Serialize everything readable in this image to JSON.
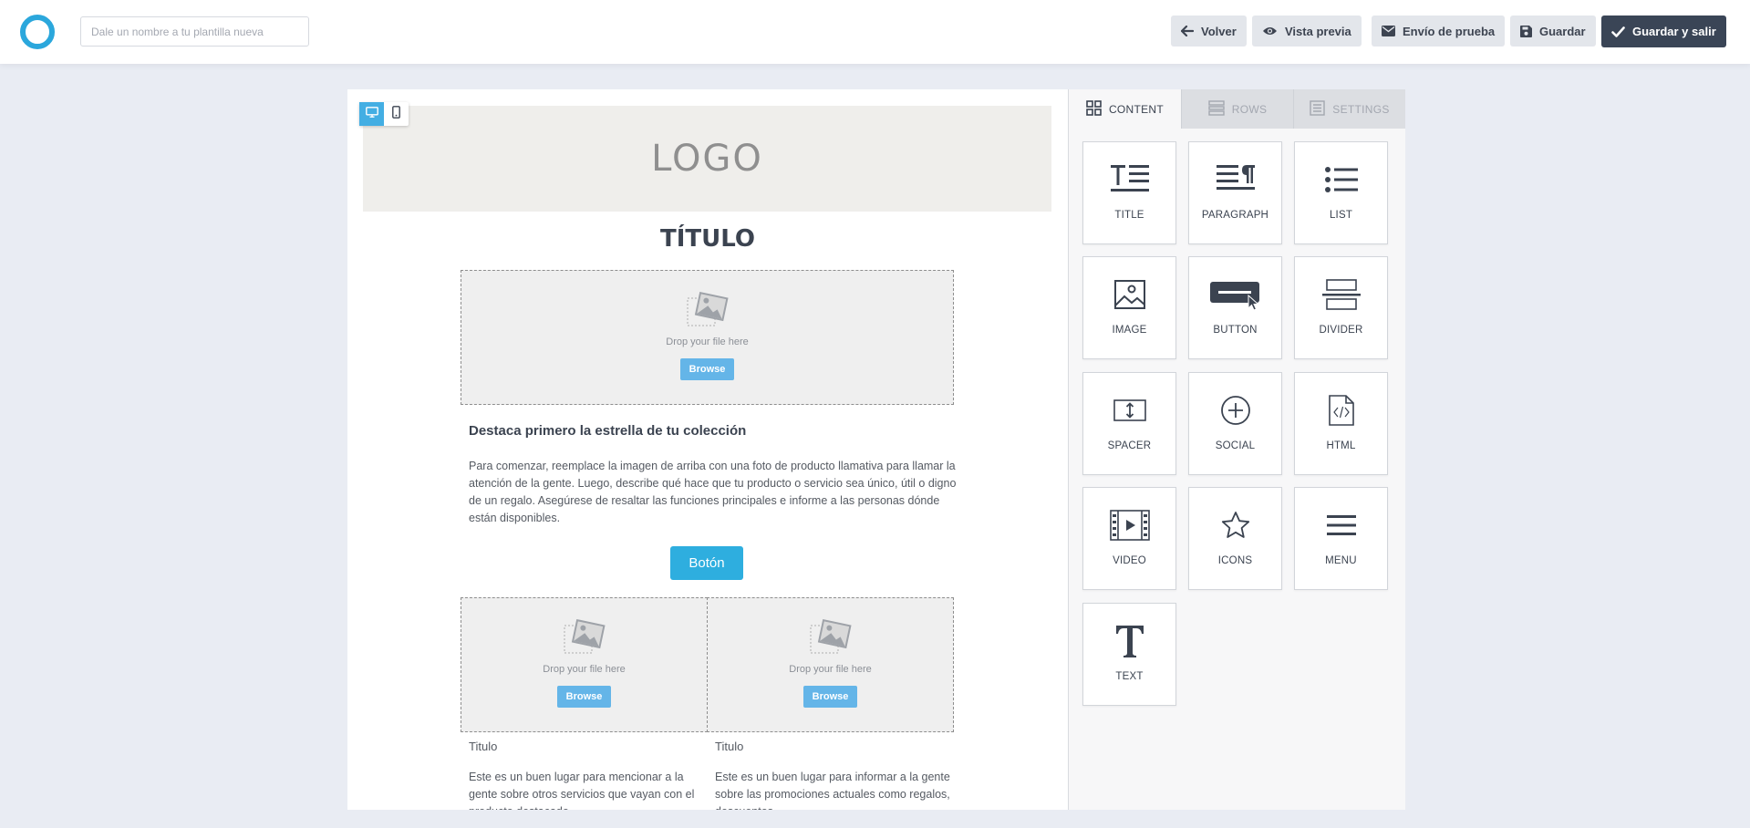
{
  "header": {
    "name_placeholder": "Dale un nombre a tu plantilla nueva",
    "buttons": {
      "back": "Volver",
      "preview": "Vista previa",
      "test_send": "Envío de prueba",
      "save": "Guardar",
      "save_exit": "Guardar y salir"
    }
  },
  "canvas": {
    "logo": "LOGO",
    "title": "TÍTULO",
    "drop_label": "Drop your file here",
    "browse_label": "Browse",
    "highlight_heading": "Destaca primero la estrella de tu colección",
    "body": "Para comenzar, reemplace la imagen de arriba con una foto de producto llamativa para llamar la atención de la gente. Luego, describe qué hace que tu producto o servicio sea único, útil o digno de un regalo. Asegúrese de resaltar las funciones principales e informe a las personas dónde están disponibles.",
    "button_label": "Botón",
    "columns": [
      {
        "title": "Titulo",
        "text": "Este es un buen lugar para mencionar a la gente sobre otros servicios que vayan con el producto destacado."
      },
      {
        "title": "Titulo",
        "text": "Este es un buen lugar para informar a la gente sobre las promociones actuales como regalos, descuentos."
      }
    ]
  },
  "panel": {
    "tabs": [
      {
        "label": "CONTENT",
        "icon": "grid-icon",
        "active": true
      },
      {
        "label": "ROWS",
        "icon": "rows-icon",
        "active": false
      },
      {
        "label": "SETTINGS",
        "icon": "settings-doc-icon",
        "active": false
      }
    ],
    "tiles": [
      {
        "label": "TITLE",
        "icon": "title-icon"
      },
      {
        "label": "PARAGRAPH",
        "icon": "paragraph-icon"
      },
      {
        "label": "LIST",
        "icon": "list-icon"
      },
      {
        "label": "IMAGE",
        "icon": "image-icon"
      },
      {
        "label": "BUTTON",
        "icon": "button-icon"
      },
      {
        "label": "DIVIDER",
        "icon": "divider-icon"
      },
      {
        "label": "SPACER",
        "icon": "spacer-icon"
      },
      {
        "label": "SOCIAL",
        "icon": "social-icon"
      },
      {
        "label": "HTML",
        "icon": "html-icon"
      },
      {
        "label": "VIDEO",
        "icon": "video-icon"
      },
      {
        "label": "ICONS",
        "icon": "star-icon"
      },
      {
        "label": "MENU",
        "icon": "menu-icon"
      },
      {
        "label": "TEXT",
        "icon": "text-icon"
      }
    ]
  },
  "colors": {
    "accent": "#2eaedf",
    "dark_button": "#3a4556",
    "background": "#e9ecf3"
  }
}
